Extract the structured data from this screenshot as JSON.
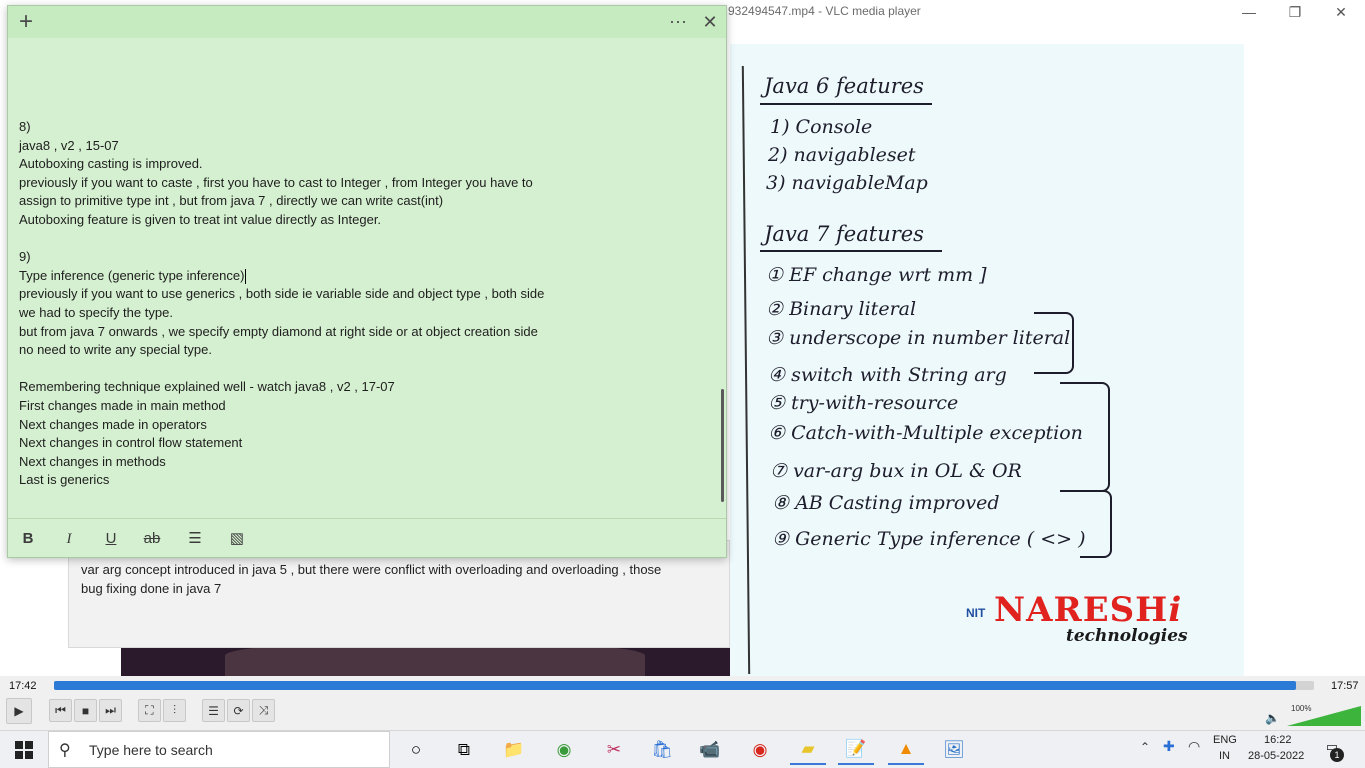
{
  "vlc": {
    "title": "932494547.mp4 - VLC media player",
    "minimize_glyph": "—",
    "maximize_glyph": "❐",
    "close_glyph": "✕"
  },
  "board": {
    "heading_java6": "Java 6 features",
    "java6_items": [
      "1) Console",
      "2) navigableset",
      "3) navigableMap"
    ],
    "heading_java7": "Java 7 features",
    "java7_items": [
      "① EF change wrt mm ]",
      "② Binary literal",
      "③ underscope in number literal",
      "④ switch with String arg",
      "⑤ try-with-resource",
      "⑥ Catch-with-Multiple exception",
      "⑦ var-arg bux in OL & OR",
      "⑧ AB Casting improved",
      "⑨ Generic Type inference ( <> )"
    ],
    "logo_main": "NARESH",
    "logo_i": "i",
    "logo_sub": "technologies",
    "logo_nit": "NIT"
  },
  "background_doc": {
    "line1": "var arg concept introduced in java 5 , but there were conflict with overloading and overloading , those",
    "line2": "bug fixing done in java 7"
  },
  "sticky": {
    "add_glyph": "+",
    "more_glyph": "···",
    "close_glyph": "✕",
    "lines": [
      "8)",
      "java8 , v2 , 15-07",
      "Autoboxing casting is improved.",
      "previously if you want to caste , first you have to cast to Integer , from Integer you have to",
      "assign to primitive type int , but from java 7 , directly we can write cast(int)",
      "Autoboxing feature is given to treat int value directly as Integer.",
      "",
      "9)",
      "Type inference (generic type inference)",
      "previously if you want to use generics , both side ie variable side and object type , both side",
      "we had to specify the type.",
      "but from java 7 onwards , we specify empty diamond at right side or at object creation side",
      "no need to write any special type.",
      "",
      "Remembering technique explained well - watch java8 , v2 , 17-07",
      "First changes made in main method",
      "Next changes made in operators",
      "Next changes in control flow statement",
      "Next changes in methods",
      "Last is generics"
    ],
    "toolbar": {
      "bold": "B",
      "italic": "I",
      "underline": "U",
      "strike": "ab",
      "list_glyph": "☰",
      "image_glyph": "▧"
    }
  },
  "player": {
    "time_current": "17:42",
    "time_total": "17:57",
    "progress": 0.986,
    "volume_label": "100%",
    "volume_level": 1.0,
    "buttons": {
      "play": "▶",
      "prev": "⏮",
      "stop": "■",
      "next": "⏭",
      "fullscreen": "⛶",
      "extended": "⫶",
      "playlist": "☰",
      "loop": "⟳",
      "shuffle": "⤨"
    }
  },
  "taskbar": {
    "search_placeholder": "Type here to search",
    "search_glyph": "⚲",
    "apps": {
      "cortana": "○",
      "task_view": "⧉",
      "explorer": "📁",
      "chrome": "◉",
      "snipping": "✂",
      "store": "🛍",
      "zoom": "📹",
      "recorder": "◉",
      "sticky_notes": "▰",
      "notepad": "📝",
      "vlc": "▲",
      "photos": "🖼"
    },
    "tray_chevron": "⌃",
    "lang1": "ENG",
    "lang2": "IN",
    "time": "16:22",
    "date": "28-05-2022",
    "notif_glyph": "▭",
    "notif_count": "1"
  },
  "colors": {
    "sticky_bg": "#d5f0d0",
    "seek_fill": "#2a7ad6",
    "logo_red": "#e1231f"
  }
}
